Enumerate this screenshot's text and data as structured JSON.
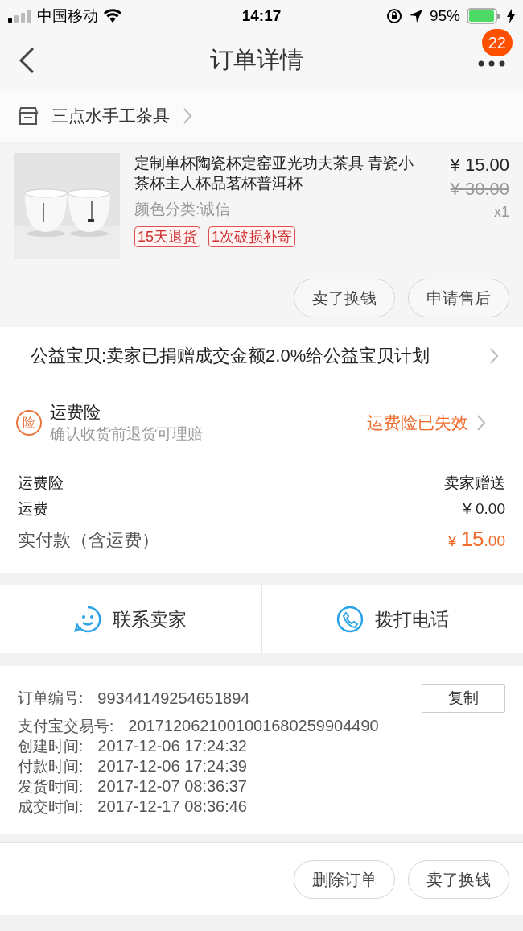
{
  "status_bar": {
    "carrier": "中国移动",
    "time": "14:17",
    "battery": "95%"
  },
  "nav": {
    "title": "订单详情",
    "badge": "22"
  },
  "shop": {
    "name": "三点水手工茶具"
  },
  "product": {
    "kind": "picture",
    "title": "定制单杯陶瓷杯定窑亚光功夫茶具 青瓷小茶杯主人杯品茗杯普洱杯",
    "variant": "颜色分类:诚信",
    "tags": [
      "15天退货",
      "1次破损补寄"
    ],
    "price": "¥ 15.00",
    "original_price": "¥ 30.00",
    "quantity": "x1",
    "buttons": [
      "卖了换钱",
      "申请售后"
    ]
  },
  "charity": {
    "text": "公益宝贝:卖家已捐赠成交金额2.0%给公益宝贝计划"
  },
  "insurance": {
    "icon_text": "险",
    "title": "运费险",
    "subtitle": "确认收货前退货可理赔",
    "status": "运费险已失效"
  },
  "fees": [
    {
      "label": "运费险",
      "value": "卖家赠送"
    },
    {
      "label": "运费",
      "value": "¥ 0.00"
    }
  ],
  "total": {
    "label": "实付款（含运费）",
    "currency": "¥ ",
    "integer": "15",
    "decimal": ".00"
  },
  "contact": [
    "联系卖家",
    "拨打电话"
  ],
  "order_info": {
    "copy_button": "复制",
    "rows": [
      {
        "label": "订单编号:",
        "value": "99344149254651894"
      },
      {
        "label": "支付宝交易号:",
        "value": "2017120621001001680259904490"
      },
      {
        "label": "创建时间:",
        "value": "2017-12-06 17:24:32"
      },
      {
        "label": "付款时间:",
        "value": "2017-12-06 17:24:39"
      },
      {
        "label": "发货时间:",
        "value": "2017-12-07 08:36:37"
      },
      {
        "label": "成交时间:",
        "value": "2017-12-17 08:36:46"
      }
    ]
  },
  "bottom_buttons": [
    "删除订单",
    "卖了换钱"
  ]
}
